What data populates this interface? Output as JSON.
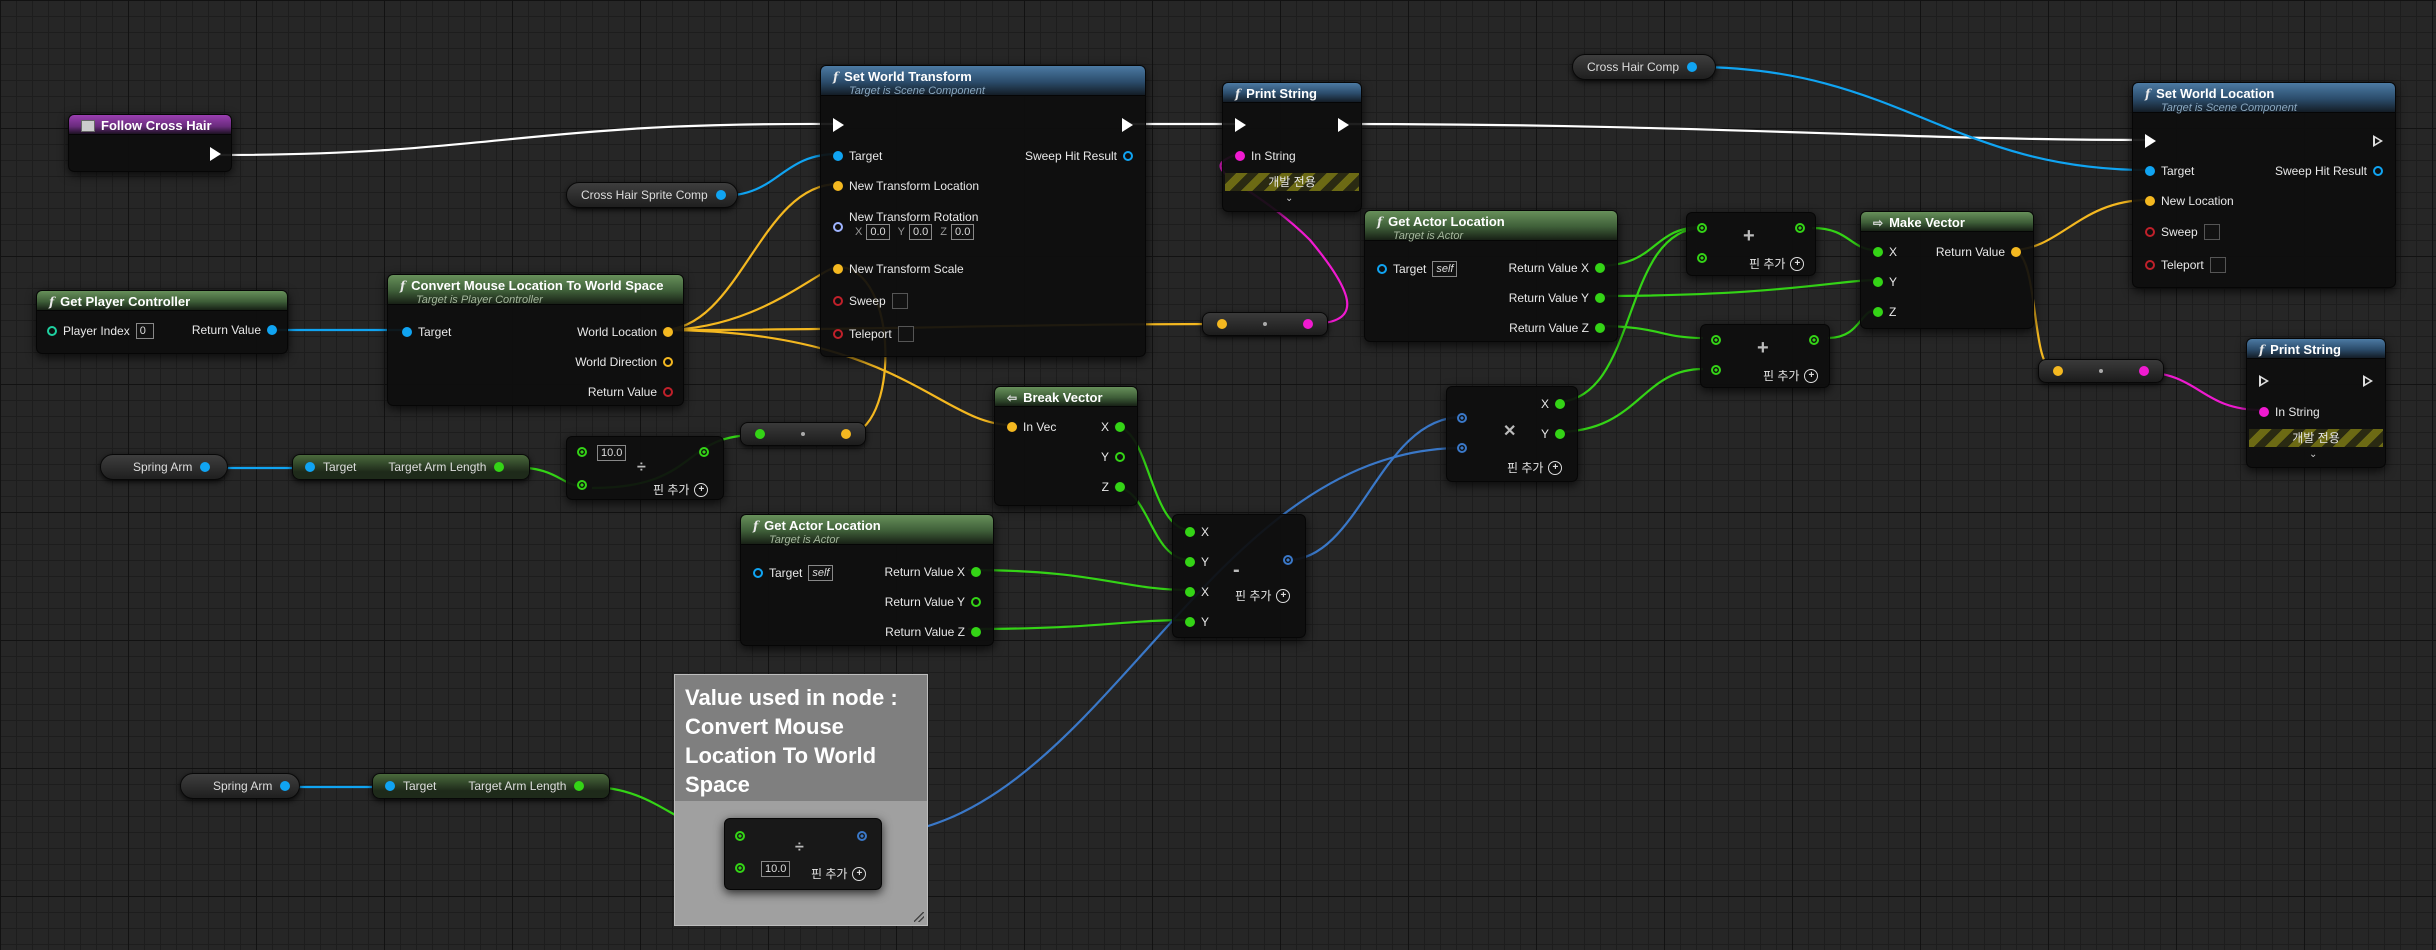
{
  "colors": {
    "exec": "#ffffff",
    "object": "#10a4f2",
    "vector": "#f4b820",
    "float": "#34d416",
    "string": "#f01ad0",
    "bool": "#c0202a",
    "header_function": "#4c7aa3",
    "header_pure": "#67905a",
    "header_event": "#9a3fb1",
    "comment": "#a0a0a0"
  },
  "event": {
    "title": "Follow Cross Hair"
  },
  "get_player_controller": {
    "title": "Get Player Controller",
    "player_index_label": "Player Index",
    "player_index_value": "0",
    "return_label": "Return Value"
  },
  "convert_mouse": {
    "title": "Convert Mouse Location To World Space",
    "subtitle": "Target is Player Controller",
    "target_label": "Target",
    "world_location": "World Location",
    "world_direction": "World Direction",
    "return_label": "Return Value"
  },
  "set_world_transform": {
    "title": "Set World Transform",
    "subtitle": "Target is Scene Component",
    "target_label": "Target",
    "sweep_hit": "Sweep Hit Result",
    "new_location": "New Transform Location",
    "new_rotation": "New Transform Rotation",
    "rot_x_label": "X",
    "rot_x": "0.0",
    "rot_y_label": "Y",
    "rot_y": "0.0",
    "rot_z_label": "Z",
    "rot_z": "0.0",
    "new_scale": "New Transform Scale",
    "sweep": "Sweep",
    "teleport": "Teleport"
  },
  "crosshair_sprite_var": {
    "label": "Cross Hair Sprite Comp"
  },
  "print_string_1": {
    "title": "Print String",
    "in_string": "In String",
    "dev_only": "개발 전용"
  },
  "crosshair_comp_var": {
    "label": "Cross Hair Comp"
  },
  "get_actor_location_1": {
    "title": "Get Actor Location",
    "subtitle": "Target is Actor",
    "target_label": "Target",
    "target_value": "self",
    "rx": "Return Value X",
    "ry": "Return Value Y",
    "rz": "Return Value Z"
  },
  "add_1": {
    "add_pin": "핀 추가"
  },
  "add_2": {
    "add_pin": "핀 추가"
  },
  "make_vector": {
    "title": "Make Vector",
    "x": "X",
    "y": "Y",
    "z": "Z",
    "return_label": "Return Value"
  },
  "set_world_location": {
    "title": "Set World Location",
    "subtitle": "Target is Scene Component",
    "target_label": "Target",
    "sweep_hit": "Sweep Hit Result",
    "new_location": "New Location",
    "sweep": "Sweep",
    "teleport": "Teleport"
  },
  "print_string_2": {
    "title": "Print String",
    "in_string": "In String",
    "dev_only": "개발 전용"
  },
  "spring_arm_1": {
    "label": "Spring Arm"
  },
  "target_arm_length_1": {
    "target_label": "Target",
    "out_label": "Target Arm Length"
  },
  "divide_1": {
    "value": "10.0",
    "add_pin": "핀 추가"
  },
  "break_vector": {
    "title": "Break Vector",
    "in_vec": "In Vec",
    "x": "X",
    "y": "Y",
    "z": "Z"
  },
  "get_actor_location_2": {
    "title": "Get Actor Location",
    "subtitle": "Target is Actor",
    "target_label": "Target",
    "target_value": "self",
    "rx": "Return Value X",
    "ry": "Return Value Y",
    "rz": "Return Value Z"
  },
  "subtract": {
    "x1": "X",
    "y1": "Y",
    "x2": "X",
    "y2": "Y",
    "add_pin": "핀 추가"
  },
  "multiply": {
    "x": "X",
    "y": "Y",
    "add_pin": "핀 추가"
  },
  "spring_arm_2": {
    "label": "Spring Arm"
  },
  "target_arm_length_2": {
    "target_label": "Target",
    "out_label": "Target Arm Length"
  },
  "comment": {
    "text": "Value used in node : Convert Mouse Location To World Space"
  },
  "divide_2": {
    "value": "10.0",
    "add_pin": "핀 추가"
  }
}
